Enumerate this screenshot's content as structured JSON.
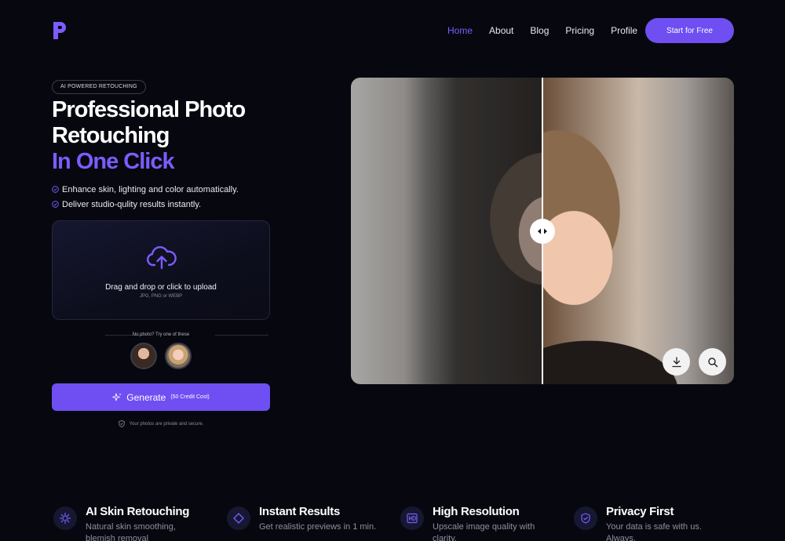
{
  "colors": {
    "accent": "#6f4ef2",
    "accent_text": "#7c5cff",
    "background": "#07080f"
  },
  "logo": {
    "letter": "P",
    "icon": "brand-p-logo"
  },
  "nav": {
    "items": [
      {
        "label": "Home",
        "active": true
      },
      {
        "label": "About",
        "active": false
      },
      {
        "label": "Blog",
        "active": false
      },
      {
        "label": "Pricing",
        "active": false
      },
      {
        "label": "Profile",
        "active": false
      }
    ],
    "cta_label": "Start for Free"
  },
  "hero": {
    "badge": "AI POWERED RETOUCHING",
    "title_line1": "Professional Photo",
    "title_line2": "Retouching",
    "title_accent": "In One Click",
    "features": [
      "Enhance skin, lighting and color automatically.",
      "Deliver studio-qulity results instantly."
    ]
  },
  "upload": {
    "icon": "cloud-upload-icon",
    "title": "Drag and drop or click to upload",
    "formats": "JPG, PNG or WEBP"
  },
  "samples": {
    "label": "No photo? Try one of these",
    "count": 2
  },
  "generate": {
    "label": "Generate",
    "cost": "(50 Credit Cost)",
    "icon": "sparkle-icon"
  },
  "privacy_note": "Your photos are private and secure.",
  "compare": {
    "slider_position": 0.5,
    "actions": [
      "download-icon",
      "zoom-icon"
    ]
  },
  "cards": [
    {
      "icon": "skin-sparkle-icon",
      "title": "AI Skin Retouching",
      "desc": "Natural skin smoothing, blemish removal"
    },
    {
      "icon": "diamond-icon",
      "title": "Instant Results",
      "desc": "Get realistic previews in 1 min."
    },
    {
      "icon": "hd-icon",
      "title": "High Resolution",
      "desc": "Upscale image quality with clarity."
    },
    {
      "icon": "shield-icon",
      "title": "Privacy First",
      "desc": "Your data is safe with us. Always."
    }
  ]
}
